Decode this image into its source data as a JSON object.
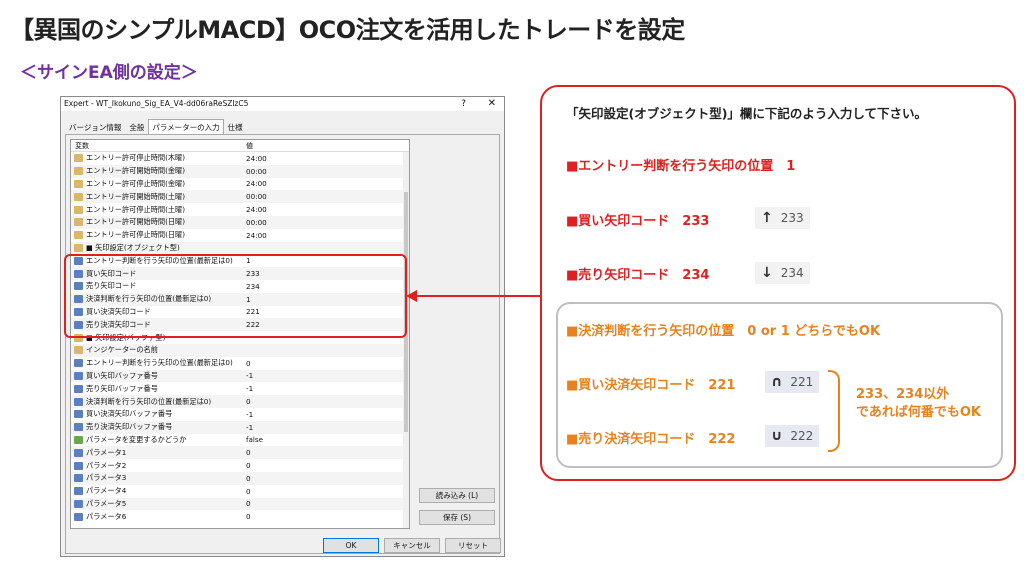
{
  "header": {
    "title": "【異国のシンプルMACD】OCO注文を活用したトレードを設定",
    "subtitle": "＜サインEA側の設定＞"
  },
  "dialog": {
    "title": "Expert - WT_Ikokuno_Sig_EA_V4-dd06raReSZlzC5",
    "help": "?",
    "close": "✕",
    "tabs": [
      "バージョン情報",
      "全般",
      "パラメーターの入力",
      "仕様"
    ],
    "col_var": "変数",
    "col_val": "値",
    "rows": [
      {
        "icon": "ab",
        "name": "エントリー許可停止時間(木曜)",
        "value": "24:00"
      },
      {
        "icon": "ab",
        "name": "エントリー許可開始時間(金曜)",
        "value": "00:00"
      },
      {
        "icon": "ab",
        "name": "エントリー許可停止時間(金曜)",
        "value": "24:00"
      },
      {
        "icon": "ab",
        "name": "エントリー許可開始時間(土曜)",
        "value": "00:00"
      },
      {
        "icon": "ab",
        "name": "エントリー許可停止時間(土曜)",
        "value": "24:00"
      },
      {
        "icon": "ab",
        "name": "エントリー許可開始時間(日曜)",
        "value": "00:00"
      },
      {
        "icon": "ab",
        "name": "エントリー許可停止時間(日曜)",
        "value": "24:00"
      },
      {
        "icon": "ab",
        "name": "■ 矢印設定(オブジェクト型)",
        "value": ""
      },
      {
        "icon": "num",
        "name": "エントリー判断を行う矢印の位置(最新足は0)",
        "value": "1"
      },
      {
        "icon": "num",
        "name": "買い矢印コード",
        "value": "233"
      },
      {
        "icon": "num",
        "name": "売り矢印コード",
        "value": "234"
      },
      {
        "icon": "num",
        "name": "決済判断を行う矢印の位置(最新足は0)",
        "value": "1"
      },
      {
        "icon": "num",
        "name": "買い決済矢印コード",
        "value": "221"
      },
      {
        "icon": "num",
        "name": "売り決済矢印コード",
        "value": "222"
      },
      {
        "icon": "ab",
        "name": "■ 矢印設定(バッファ型)",
        "value": ""
      },
      {
        "icon": "ab",
        "name": "インジケーターの名前",
        "value": ""
      },
      {
        "icon": "num",
        "name": "エントリー判断を行う矢印の位置(最新足は0)",
        "value": "0"
      },
      {
        "icon": "num",
        "name": "買い矢印バッファ番号",
        "value": "-1"
      },
      {
        "icon": "num",
        "name": "売り矢印バッファ番号",
        "value": "-1"
      },
      {
        "icon": "num",
        "name": "決済判断を行う矢印の位置(最新足は0)",
        "value": "0"
      },
      {
        "icon": "num",
        "name": "買い決済矢印バッファ番号",
        "value": "-1"
      },
      {
        "icon": "num",
        "name": "売り決済矢印バッファ番号",
        "value": "-1"
      },
      {
        "icon": "bool",
        "name": "パラメータを変更するかどうか",
        "value": "false"
      },
      {
        "icon": "num",
        "name": "パラメータ1",
        "value": "0"
      },
      {
        "icon": "num",
        "name": "パラメータ2",
        "value": "0"
      },
      {
        "icon": "num",
        "name": "パラメータ3",
        "value": "0"
      },
      {
        "icon": "num",
        "name": "パラメータ4",
        "value": "0"
      },
      {
        "icon": "num",
        "name": "パラメータ5",
        "value": "0"
      },
      {
        "icon": "num",
        "name": "パラメータ6",
        "value": "0"
      }
    ],
    "btn_load": "読み込み (L)",
    "btn_save": "保存 (S)",
    "btn_ok": "OK",
    "btn_cancel": "キャンセル",
    "btn_reset": "リセット"
  },
  "info": {
    "title": "「矢印設定(オブジェクト型)」欄に下記のよう入力して下さい。",
    "entry_pos": "■エントリー判断を行う矢印の位置　1",
    "buy_arrow": "■買い矢印コード　233",
    "buy_glyph": "↑",
    "buy_code": "233",
    "sell_arrow": "■売り矢印コード　234",
    "sell_glyph": "↓",
    "sell_code": "234",
    "exit_pos": "■決済判断を行う矢印の位置　0 or 1 どちらでもOK",
    "buy_exit": "■買い決済矢印コード　221",
    "buy_exit_glyph": "∩",
    "buy_exit_code": "221",
    "sell_exit": "■売り決済矢印コード　222",
    "sell_exit_glyph": "∪",
    "sell_exit_code": "222",
    "note_line1": "233、234以外",
    "note_line2": "であれば何番でもOK"
  },
  "colors": {
    "accent_red": "#e02020",
    "accent_orange": "#e8821e",
    "subtitle_purple": "#7030a0"
  }
}
